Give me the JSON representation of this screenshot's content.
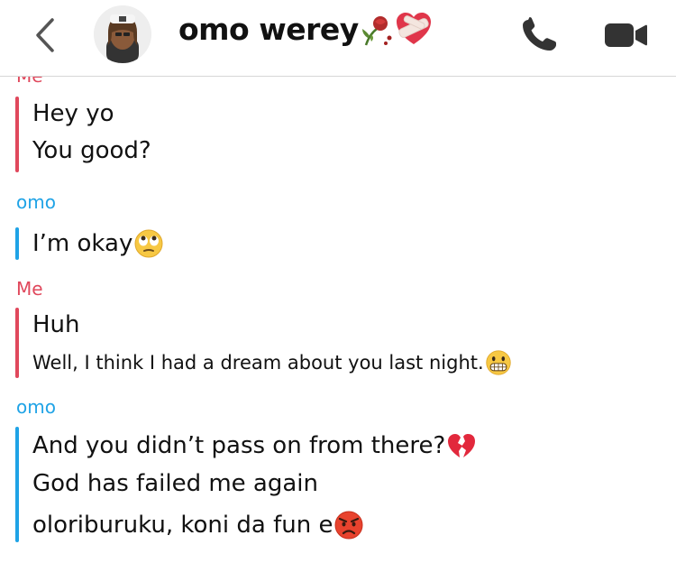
{
  "header": {
    "contact_name": "omo werey",
    "title_emojis": [
      "wilted-rose",
      "mending-heart"
    ]
  },
  "messages": [
    {
      "sender": "Me",
      "lines": [
        "Hey yo",
        "You good?"
      ]
    },
    {
      "sender": "omo",
      "lines": [
        "I’m okay"
      ]
    },
    {
      "sender": "Me",
      "lines": [
        "Huh",
        "Well, I think I had a dream about you last night."
      ]
    },
    {
      "sender": "omo",
      "lines": [
        "And you didn’t pass on from there?",
        "God has failed me again",
        "oloriburuku, koni da fun e"
      ]
    }
  ],
  "colors": {
    "me": "#e0485c",
    "omo": "#1fa3e6"
  },
  "icons": {
    "back": "chevron-left-icon",
    "call": "phone-icon",
    "video": "video-camera-icon"
  }
}
